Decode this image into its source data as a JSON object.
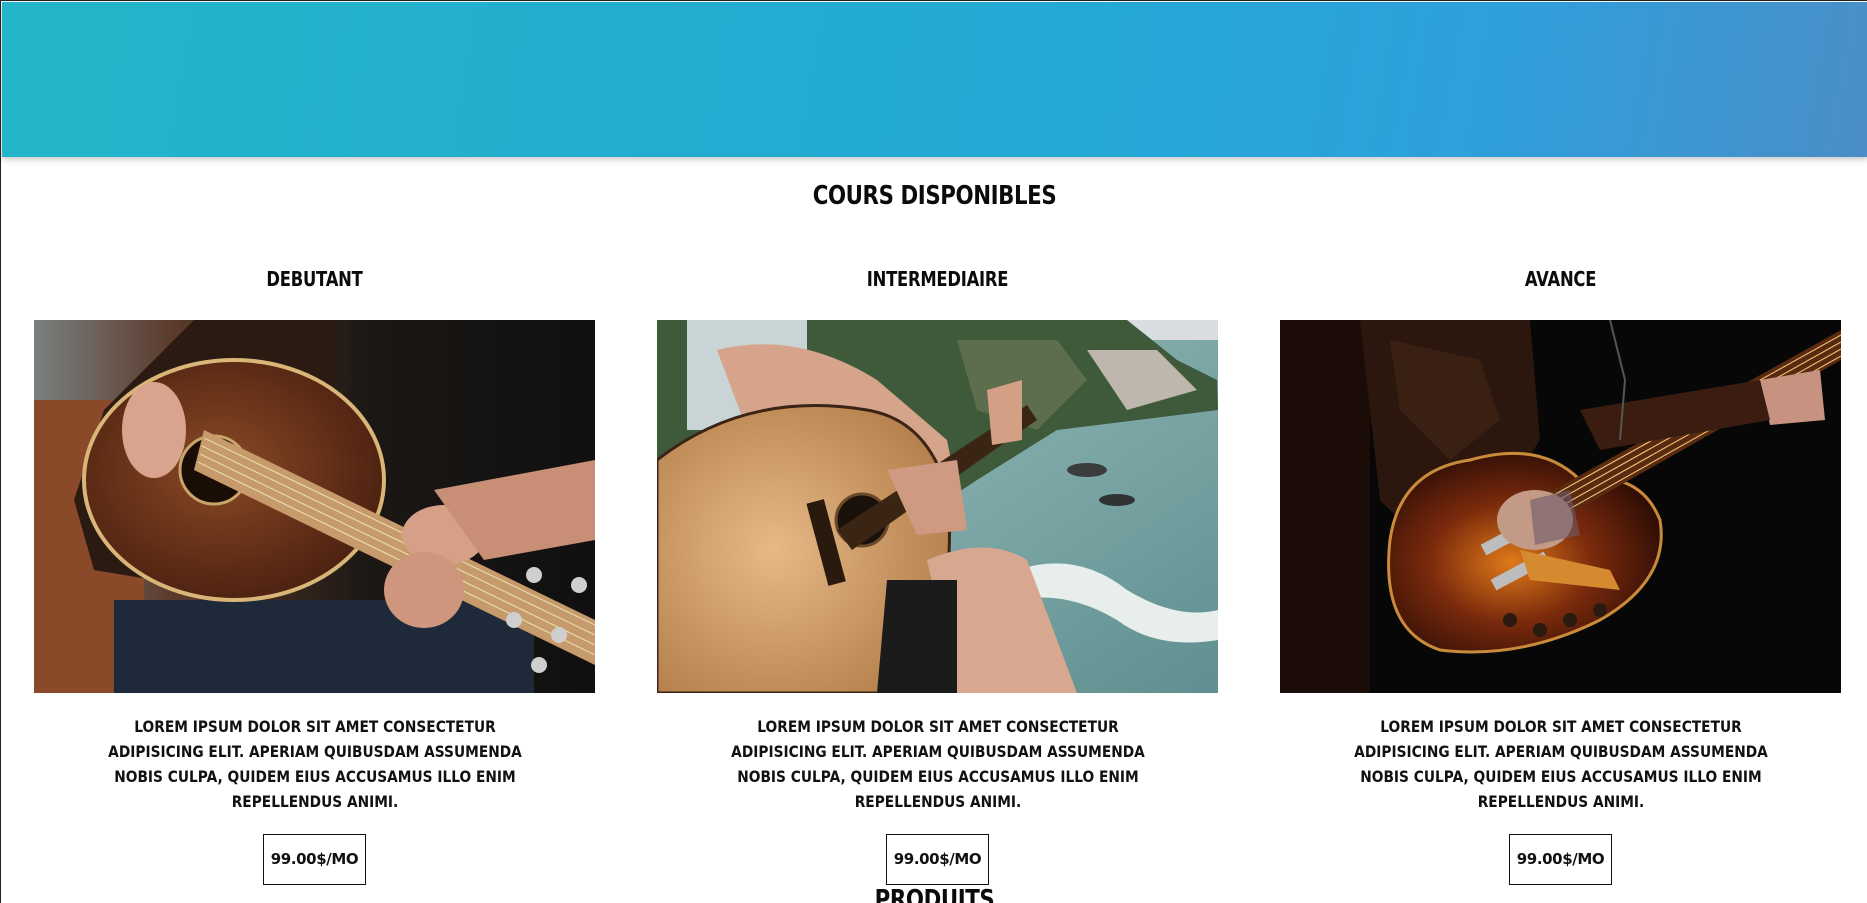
{
  "hero": {
    "colors": {
      "start": "#23b5c9",
      "mid": "#22a9d4",
      "end": "#4a8ec7"
    }
  },
  "courses_section": {
    "title": "COURS DISPONIBLES",
    "cards": [
      {
        "title": "DEBUTANT",
        "image_icon": "acoustic-guitar-photo",
        "description": "LOREM IPSUM DOLOR SIT AMET CONSECTETUR ADIPISICING ELIT. APERIAM QUIBUSDAM ASSUMENDA NOBIS CULPA, QUIDEM EIUS ACCUSAMUS ILLO ENIM REPELLENDUS ANIMI.",
        "price": "99.00$/MO"
      },
      {
        "title": "INTERMEDIAIRE",
        "image_icon": "guitar-by-sea-photo",
        "description": "LOREM IPSUM DOLOR SIT AMET CONSECTETUR ADIPISICING ELIT. APERIAM QUIBUSDAM ASSUMENDA NOBIS CULPA, QUIDEM EIUS ACCUSAMUS ILLO ENIM REPELLENDUS ANIMI.",
        "price": "99.00$/MO"
      },
      {
        "title": "AVANCE",
        "image_icon": "electric-guitar-photo",
        "description": "LOREM IPSUM DOLOR SIT AMET CONSECTETUR ADIPISICING ELIT. APERIAM QUIBUSDAM ASSUMENDA NOBIS CULPA, QUIDEM EIUS ACCUSAMUS ILLO ENIM REPELLENDUS ANIMI.",
        "price": "99.00$/MO"
      }
    ]
  },
  "products_section": {
    "title": "PRODUITS"
  }
}
